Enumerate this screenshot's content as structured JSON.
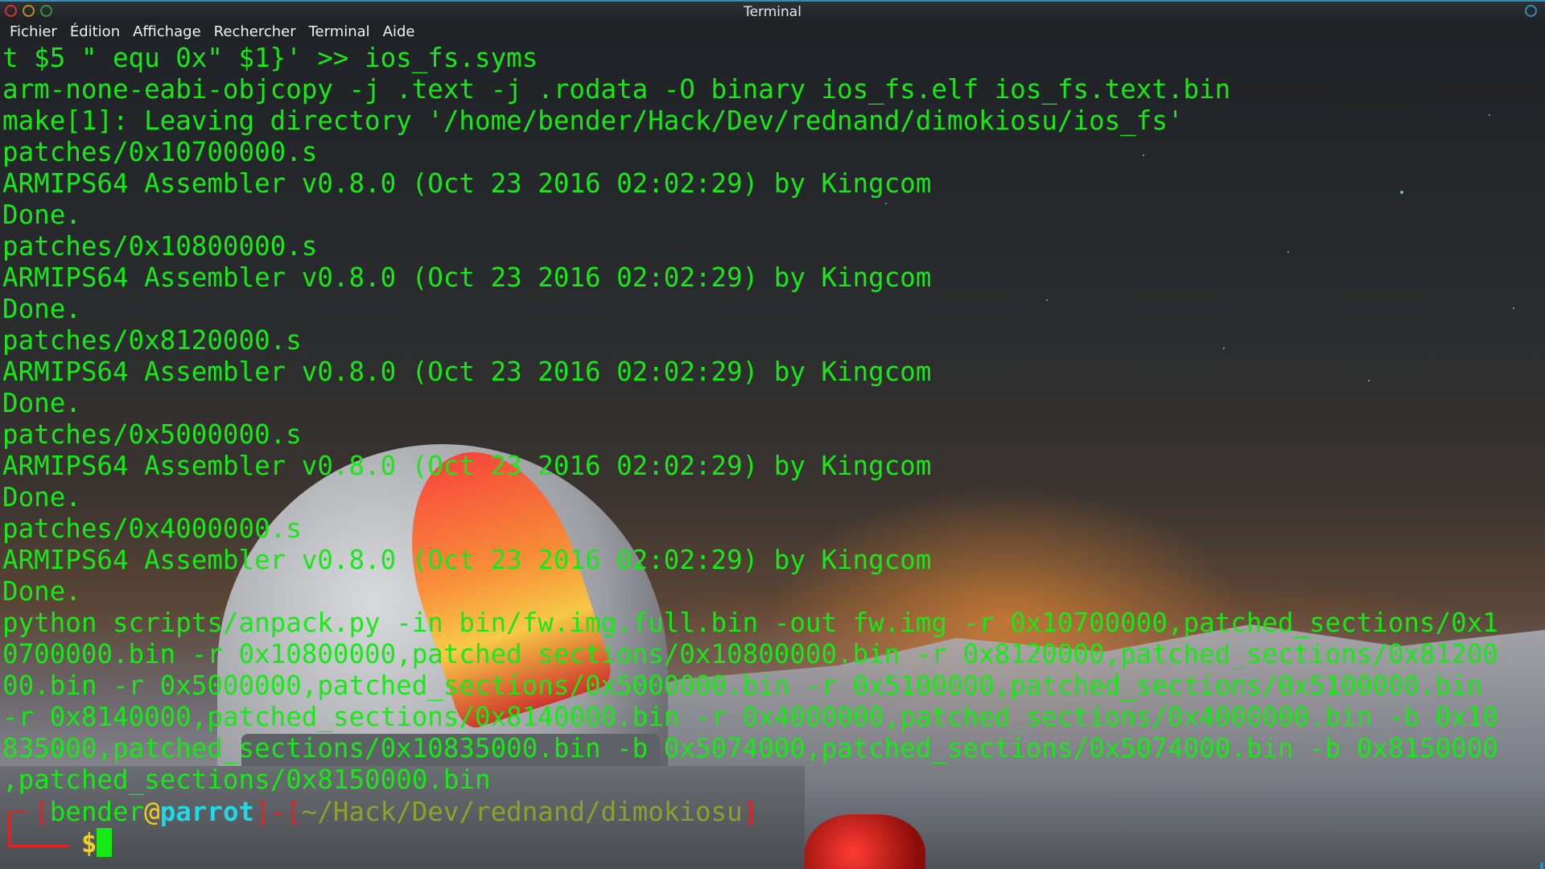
{
  "window": {
    "title": "Terminal"
  },
  "menubar": {
    "items": [
      {
        "label": "Fichier"
      },
      {
        "label": "Édition"
      },
      {
        "label": "Affichage"
      },
      {
        "label": "Rechercher"
      },
      {
        "label": "Terminal"
      },
      {
        "label": "Aide"
      }
    ]
  },
  "terminal": {
    "output": "t $5 \" equ 0x\" $1}' >> ios_fs.syms\narm-none-eabi-objcopy -j .text -j .rodata -O binary ios_fs.elf ios_fs.text.bin\nmake[1]: Leaving directory '/home/bender/Hack/Dev/rednand/dimokiosu/ios_fs'\npatches/0x10700000.s\nARMIPS64 Assembler v0.8.0 (Oct 23 2016 02:02:29) by Kingcom\nDone.\npatches/0x10800000.s\nARMIPS64 Assembler v0.8.0 (Oct 23 2016 02:02:29) by Kingcom\nDone.\npatches/0x8120000.s\nARMIPS64 Assembler v0.8.0 (Oct 23 2016 02:02:29) by Kingcom\nDone.\npatches/0x5000000.s\nARMIPS64 Assembler v0.8.0 (Oct 23 2016 02:02:29) by Kingcom\nDone.\npatches/0x4000000.s\nARMIPS64 Assembler v0.8.0 (Oct 23 2016 02:02:29) by Kingcom\nDone.\npython scripts/anpack.py -in bin/fw.img.full.bin -out fw.img -r 0x10700000,patched_sections/0x1\n0700000.bin -r 0x10800000,patched_sections/0x10800000.bin -r 0x8120000,patched_sections/0x81200\n00.bin -r 0x5000000,patched_sections/0x5000000.bin -r 0x5100000,patched_sections/0x5100000.bin\n-r 0x8140000,patched_sections/0x8140000.bin -r 0x4000000,patched_sections/0x4000000.bin -b 0x10\n835000,patched_sections/0x10835000.bin -b 0x5074000,patched_sections/0x5074000.bin -b 0x8150000\n,patched_sections/0x8150000.bin",
    "prompt": {
      "user": "bender",
      "at": "@",
      "host": "parrot",
      "cwd": "~/Hack/Dev/rednand/dimokiosu",
      "symbol": "$"
    }
  },
  "colors": {
    "text": "#17e917",
    "prompt_bracket": "#e02424",
    "host": "#20d8e6",
    "at": "#f0d020"
  }
}
